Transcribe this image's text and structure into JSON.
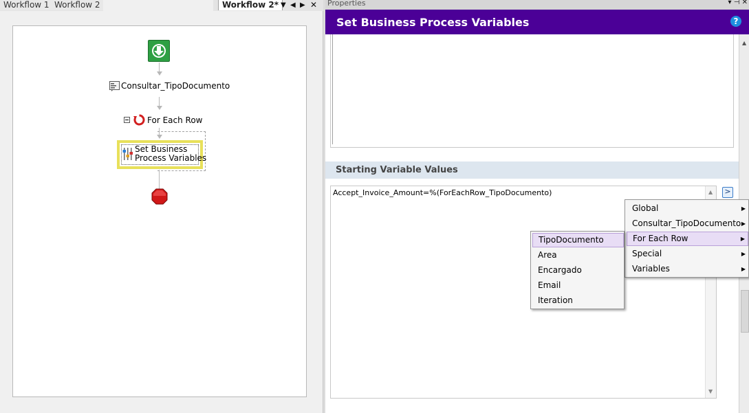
{
  "tabs": [
    {
      "label": "Workflow 1"
    },
    {
      "label": "Workflow 2"
    },
    {
      "label": "Workflow 2*"
    }
  ],
  "tab_controls": {
    "dropdown": "▼",
    "prev": "◀",
    "next": "▶",
    "close": "✕"
  },
  "workflow": {
    "nodes": [
      {
        "label": "Consultar_TipoDocumento"
      },
      {
        "label": "For Each Row"
      },
      {
        "label": "Set Business\nProcess Variables"
      }
    ]
  },
  "properties": {
    "panel_title": "Properties",
    "pin_controls": "▾ ⊣ ✕",
    "header_title": "Set Business Process Variables",
    "help_label": "?",
    "section_title": "Starting Variable Values",
    "text_value": "Accept_Invoice_Amount=%(ForEachRow_TipoDocumento)",
    "insert_label": ">"
  },
  "menu_primary": [
    {
      "label": "Global"
    },
    {
      "label": "Consultar_TipoDocumento"
    },
    {
      "label": "For Each Row"
    },
    {
      "label": "Special"
    },
    {
      "label": "Variables"
    }
  ],
  "menu_secondary": [
    {
      "label": "TipoDocumento"
    },
    {
      "label": "Area"
    },
    {
      "label": "Encargado"
    },
    {
      "label": "Email"
    },
    {
      "label": "Iteration"
    }
  ],
  "colors": {
    "header_bg": "#4b0097",
    "selection_outline": "#e8e05a",
    "start_icon": "#2ea043",
    "stop_icon": "#d01818",
    "menu_highlight": "#e8ddf5"
  }
}
